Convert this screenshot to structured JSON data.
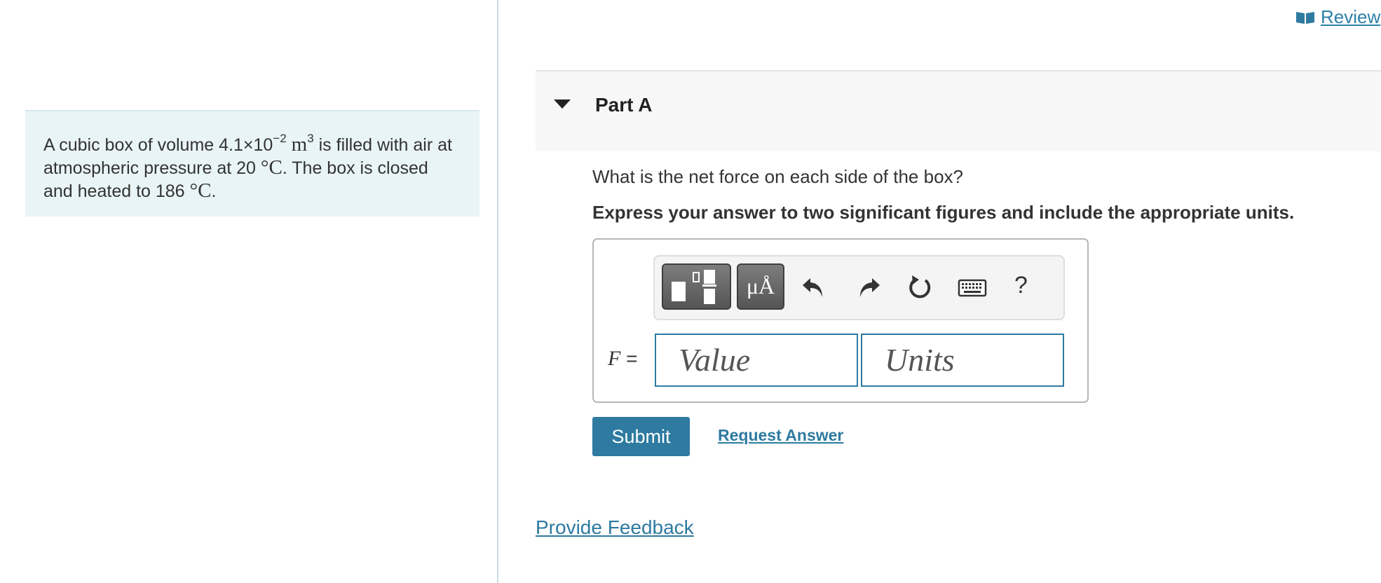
{
  "review": {
    "label": "Review"
  },
  "problem": {
    "prefix": "A cubic box of volume 4.1×10",
    "vol_exp": "−2",
    "vol_unit": "m",
    "vol_unit_exp": "3",
    "mid1": " is filled with air at atmospheric pressure at 20 ",
    "deg1": "°C",
    "mid2": ". The box is closed and heated to 186 ",
    "deg2": "°C",
    "end": "."
  },
  "part": {
    "title": "Part A"
  },
  "question": {
    "text": "What is the net force on each side of the box?"
  },
  "instruction": {
    "text": "Express your answer to two significant figures and include the appropriate units."
  },
  "toolbar": {
    "units_label": "μÅ",
    "help_label": "?",
    "icons": [
      "templates-icon",
      "units-icon",
      "undo-icon",
      "redo-icon",
      "reset-icon",
      "keyboard-icon",
      "help-icon"
    ]
  },
  "answer": {
    "variable": "F",
    "equals": " =",
    "value_placeholder": "Value",
    "units_placeholder": "Units"
  },
  "actions": {
    "submit_label": "Submit",
    "request_label": "Request Answer"
  },
  "footer": {
    "feedback_label": "Provide Feedback"
  },
  "colors": {
    "accent": "#2e7aa0",
    "problem_bg": "#e9f4f6",
    "header_bg": "#f7f7f7"
  }
}
